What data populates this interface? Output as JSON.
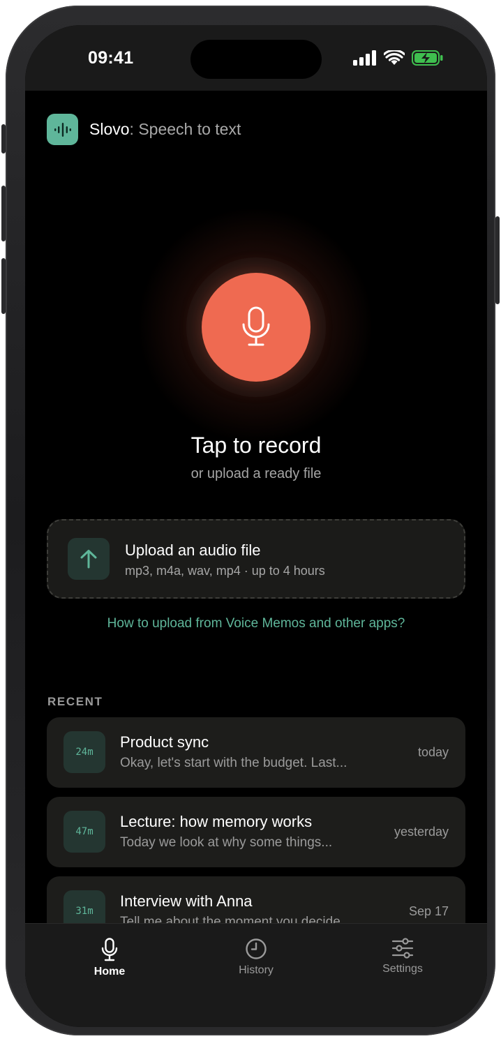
{
  "status_bar": {
    "time": "09:41"
  },
  "header": {
    "app_name": "Slovo",
    "separator": ":",
    "subtitle": " Speech to text"
  },
  "record": {
    "title": "Tap to record",
    "subtitle": "or upload a ready file"
  },
  "upload": {
    "title": "Upload an audio file",
    "subtitle": "mp3, m4a, wav, mp4 · up to 4 hours"
  },
  "help_link": "How to upload from Voice Memos and other apps?",
  "recent": {
    "label": "RECENT",
    "items": [
      {
        "duration": "24m",
        "title": "Product sync",
        "preview": "Okay, let's start with the budget. Last...",
        "date": "today"
      },
      {
        "duration": "47m",
        "title": "Lecture: how memory works",
        "preview": "Today we look at why some things...",
        "date": "yesterday"
      },
      {
        "duration": "31m",
        "title": "Interview with Anna",
        "preview": "Tell me about the moment you decide...",
        "date": "Sep 17"
      }
    ]
  },
  "tabs": [
    {
      "label": "Home",
      "icon": "mic-icon",
      "active": true
    },
    {
      "label": "History",
      "icon": "clock-icon",
      "active": false
    },
    {
      "label": "Settings",
      "icon": "sliders-icon",
      "active": false
    }
  ],
  "colors": {
    "accent": "#5fb69a",
    "record": "#ef6a51",
    "background": "#000000",
    "card": "#1d1d1b"
  }
}
